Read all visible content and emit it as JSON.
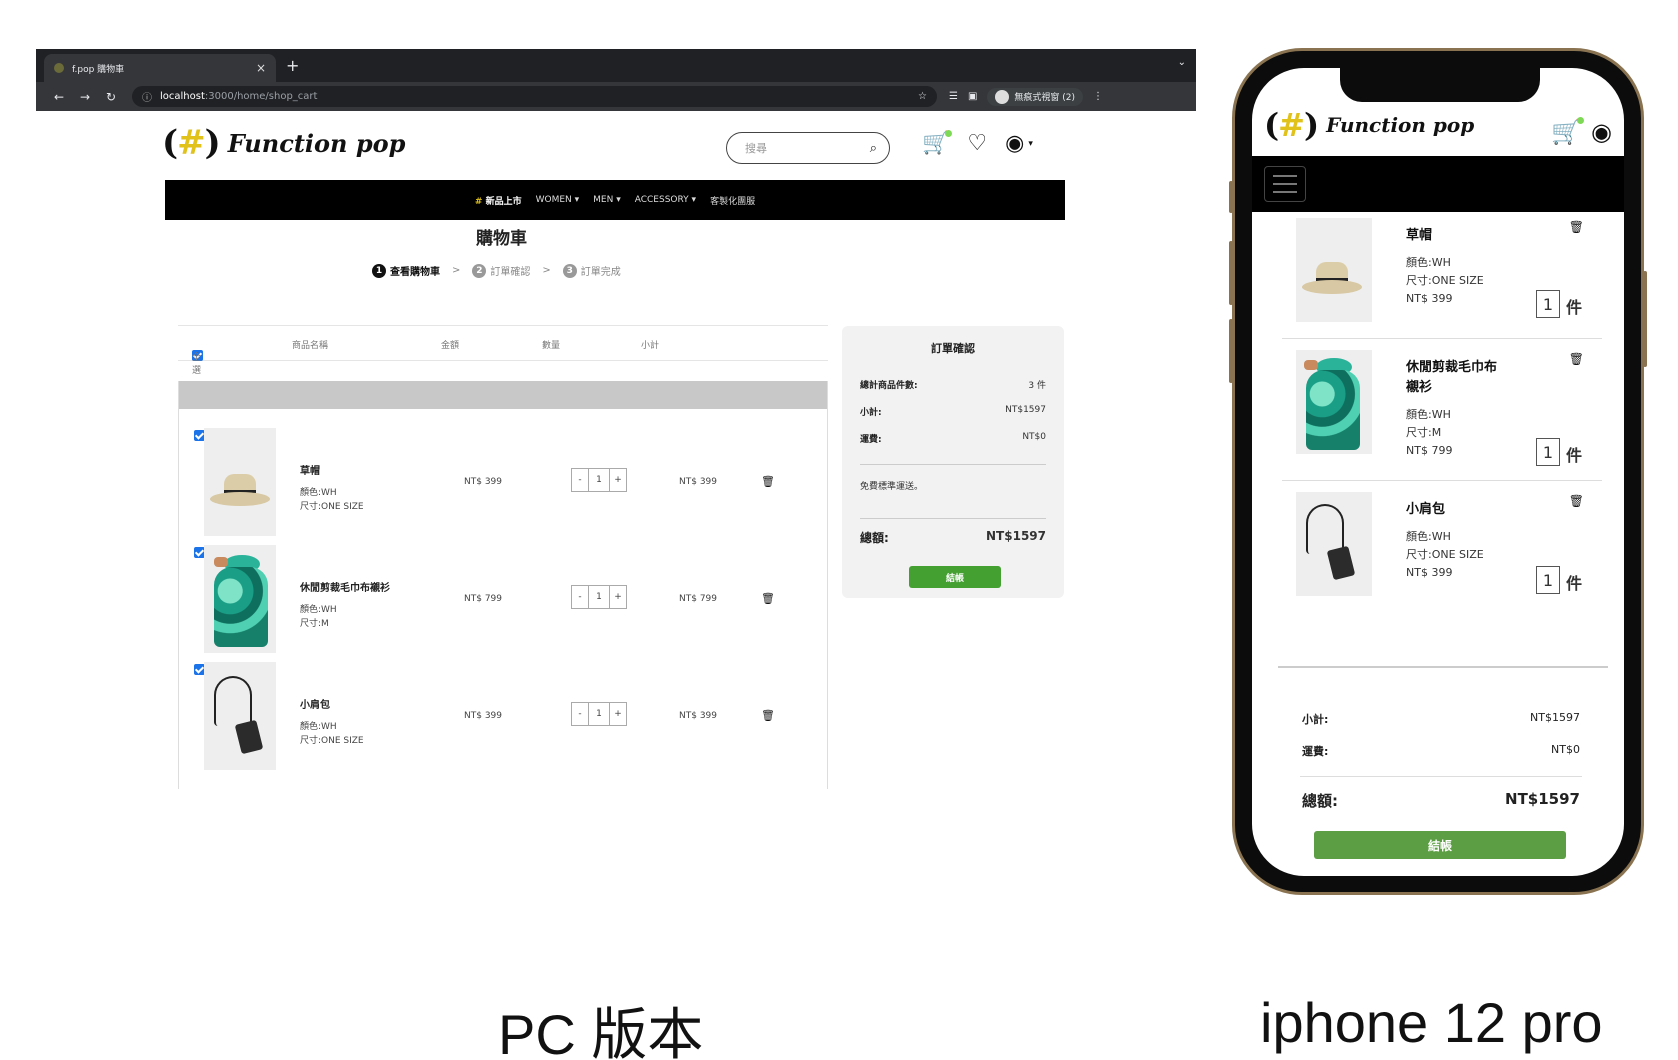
{
  "browser": {
    "tab_title": "f.pop 購物車",
    "tab_close": "×",
    "new_tab": "+",
    "tab_menu": "⌄",
    "url_host": "localhost",
    "url_path": ":3000/home/shop_cart",
    "profile_label": "無痕式視窗 (2)",
    "back": "←",
    "forward": "→",
    "reload": "↻"
  },
  "brand": {
    "logo_mark": "(",
    "logo_hash": "#",
    "logo_mark_end": ")",
    "logo_text": "Function pop"
  },
  "header": {
    "search_placeholder": "搜尋"
  },
  "nav": {
    "new_hash": "#",
    "new_label": "新品上市",
    "items": [
      "WOMEN ▾",
      "MEN ▾",
      "ACCESSORY ▾",
      "客製化團服"
    ]
  },
  "page": {
    "title": "購物車",
    "steps": [
      {
        "num": "1",
        "label": "查看購物車"
      },
      {
        "num": "2",
        "label": "訂單確認"
      },
      {
        "num": "3",
        "label": "訂單完成"
      }
    ],
    "step_sep": ">"
  },
  "table": {
    "select_all": "全選",
    "col_name": "商品名稱",
    "col_price": "金額",
    "col_qty": "數量",
    "col_subtotal": "小計"
  },
  "items": [
    {
      "name": "草帽",
      "color": "顏色:WH",
      "size": "尺寸:ONE SIZE",
      "price": "NT$ 399",
      "qty": "1",
      "subtotal": "NT$ 399",
      "mobile_name": "草帽"
    },
    {
      "name": "休閒剪裁毛巾布襯衫",
      "color": "顏色:WH",
      "size": "尺寸:M",
      "price": "NT$ 799",
      "qty": "1",
      "subtotal": "NT$ 799",
      "mobile_name": "休閒剪裁毛巾布襯衫"
    },
    {
      "name": "小肩包",
      "color": "顏色:WH",
      "size": "尺寸:ONE SIZE",
      "price": "NT$ 399",
      "qty": "1",
      "subtotal": "NT$ 399",
      "mobile_name": "小肩包"
    }
  ],
  "stepper": {
    "minus": "-",
    "plus": "+"
  },
  "summary": {
    "title": "訂單確認",
    "count_label": "總計商品件數:",
    "count_value": "3 件",
    "subtotal_label": "小計:",
    "subtotal_value": "NT$1597",
    "shipping_label": "運費:",
    "shipping_value": "NT$0",
    "free_note": "免費標準運送。",
    "total_label": "總額:",
    "total_value": "NT$1597",
    "checkout": "結帳"
  },
  "mobile": {
    "unit": "件",
    "subtotal_label": "小計:",
    "subtotal_value": "NT$1597",
    "shipping_label": "運費:",
    "shipping_value": "NT$0",
    "total_label": "總額:",
    "total_value": "NT$1597",
    "checkout": "結帳"
  },
  "captions": {
    "pc": "PC 版本",
    "phone": "iphone 12 pro"
  },
  "colors": {
    "checkout_green": "#43a031",
    "nav_black": "#000000",
    "logo_yellow": "#e0c21b",
    "phone_frame": "#8a7350"
  }
}
